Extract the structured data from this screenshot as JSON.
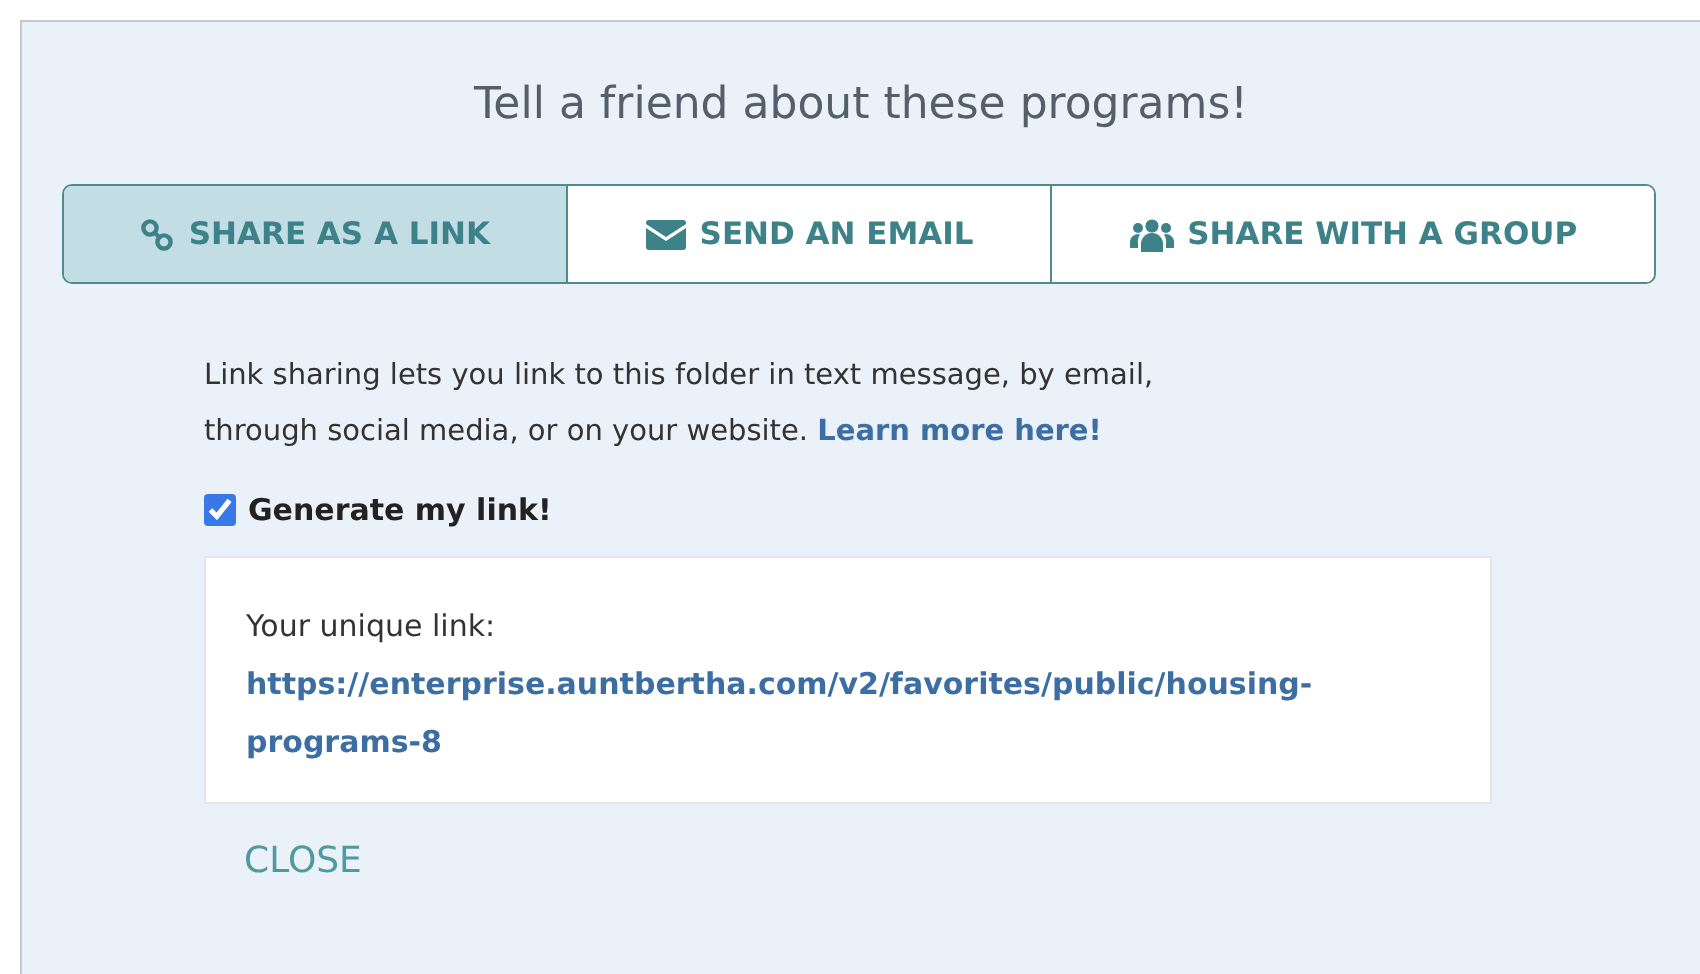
{
  "title": "Tell a friend about these programs!",
  "tabs": [
    {
      "label": "SHARE AS A LINK",
      "kind": "link",
      "selected": true
    },
    {
      "label": "SEND AN EMAIL",
      "kind": "email",
      "selected": false
    },
    {
      "label": "SHARE WITH A GROUP",
      "kind": "group",
      "selected": false
    }
  ],
  "description": "Link sharing lets you link to this folder in text message, by email, through social media, or on your website.",
  "learn_more_link": "Learn more here!",
  "generate_checkbox": {
    "label": "Generate my link!",
    "checked": true
  },
  "link_box": {
    "label": "Your unique link:",
    "url": "https://enterprise.auntbertha.com/v2/favorites/public/housing-programs-8"
  },
  "close_button": "CLOSE"
}
